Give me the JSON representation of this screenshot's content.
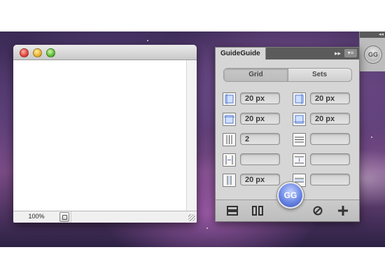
{
  "document_window": {
    "zoom_level": "100%"
  },
  "side_strip": {
    "collapse_glyph": "◂◂",
    "logo_text": "GG"
  },
  "panel": {
    "title": "GuideGuide",
    "collapse_glyph": "▸▸",
    "menu_glyph": "▾≡",
    "tabs": [
      {
        "label": "Grid",
        "active": true
      },
      {
        "label": "Sets",
        "active": false
      }
    ],
    "rows": [
      {
        "left_icon": "left-margin-icon",
        "left_value": "20 px",
        "right_icon": "right-margin-icon",
        "right_value": "20 px"
      },
      {
        "left_icon": "top-margin-icon",
        "left_value": "20 px",
        "right_icon": "bottom-margin-icon",
        "right_value": "20 px"
      },
      {
        "left_icon": "columns-icon",
        "left_value": "2",
        "right_icon": "rows-icon",
        "right_value": ""
      },
      {
        "left_icon": "column-width-icon",
        "left_value": "",
        "right_icon": "row-height-icon",
        "right_value": ""
      },
      {
        "left_icon": "column-gutter-icon",
        "left_value": "20 px",
        "right_icon": "row-gutter-icon",
        "right_value": ""
      }
    ],
    "footer": {
      "gg_button": "GG"
    }
  }
}
